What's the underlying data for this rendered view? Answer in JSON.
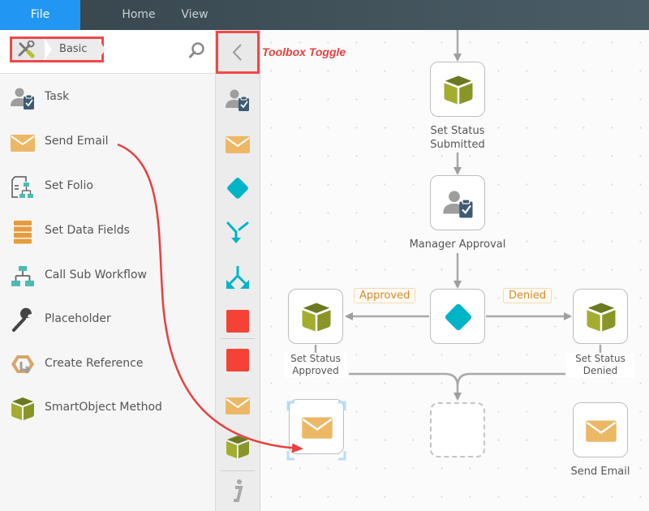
{
  "topbar": {
    "tabs": [
      {
        "label": "File",
        "active": true
      },
      {
        "label": "Home",
        "active": false
      },
      {
        "label": "View",
        "active": false
      }
    ]
  },
  "toolbox": {
    "breadcrumb": {
      "icon": "tools-icon",
      "label": "Basic"
    },
    "search_icon": "search-icon",
    "items": [
      {
        "label": "Task",
        "icon": "task-icon"
      },
      {
        "label": "Send Email",
        "icon": "email-icon"
      },
      {
        "label": "Set Folio",
        "icon": "folio-icon"
      },
      {
        "label": "Set Data Fields",
        "icon": "data-fields-icon"
      },
      {
        "label": "Call Sub Workflow",
        "icon": "sub-workflow-icon"
      },
      {
        "label": "Placeholder",
        "icon": "wrench-icon"
      },
      {
        "label": "Create Reference",
        "icon": "reference-icon"
      },
      {
        "label": "SmartObject Method",
        "icon": "smartobject-icon"
      }
    ]
  },
  "strip": {
    "toggle_icon": "chevron-left-icon",
    "icons": [
      "task-icon",
      "email-icon",
      "decision-icon",
      "merge-icon",
      "split-icon",
      "stop-icon",
      "stop-icon",
      "email-icon",
      "smartobject-icon",
      "info-icon"
    ]
  },
  "annotation": {
    "text": "Toolbox Toggle",
    "color": "#e8403f"
  },
  "canvas": {
    "nodes": [
      {
        "label": "Set Status Submitted",
        "line1": "Set Status",
        "line2": "Submitted",
        "icon": "smartobject-icon"
      },
      {
        "label": "Manager Approval",
        "icon": "task-icon"
      },
      {
        "label": "Decision",
        "icon": "decision-icon"
      },
      {
        "label": "Set Status Approved",
        "line1": "Set Status",
        "line2": "Approved",
        "icon": "smartobject-icon"
      },
      {
        "label": "Set Status Denied",
        "line1": "Set Status",
        "line2": "Denied",
        "icon": "smartobject-icon"
      },
      {
        "label": "",
        "icon": "email-icon",
        "selected": true
      },
      {
        "label": "",
        "icon": "",
        "placeholder": true
      },
      {
        "label": "Send Email",
        "icon": "email-icon"
      }
    ],
    "rules": [
      {
        "label": "Approved"
      },
      {
        "label": "Denied"
      }
    ]
  },
  "colors": {
    "accent": "#2196f3",
    "annotation": "#e8403f",
    "email": "#ecb865",
    "decision": "#00b4c8",
    "smartobject": "#a4ad2f",
    "stop": "#f44336",
    "rule_text": "#d98b2b"
  }
}
